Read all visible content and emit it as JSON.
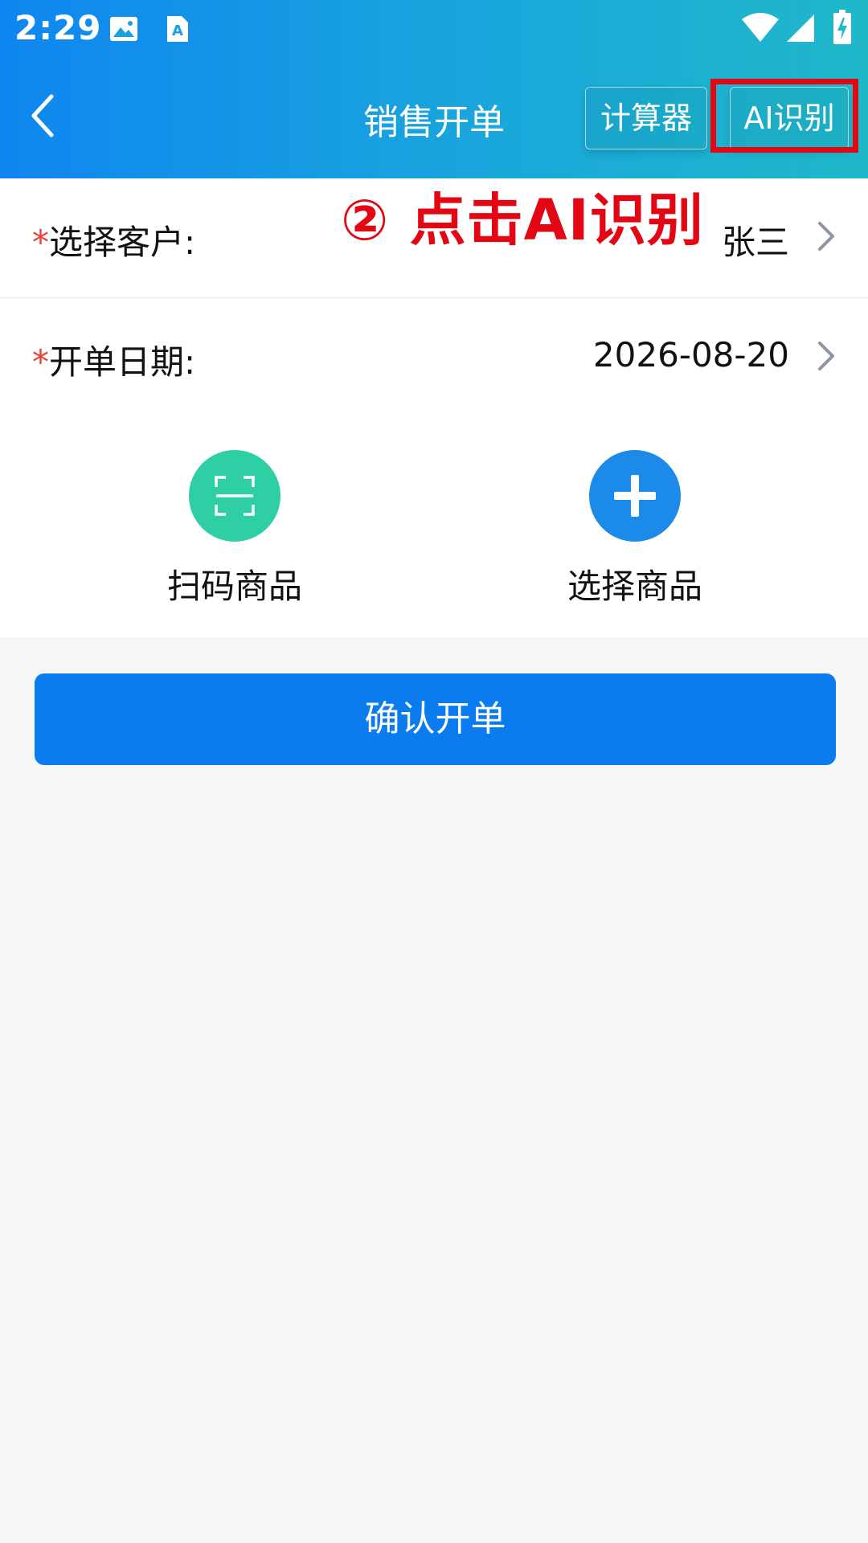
{
  "status_bar": {
    "time": "2:29"
  },
  "navbar": {
    "title": "销售开单",
    "calculator_label": "计算器",
    "ai_label": "AI识别"
  },
  "annotation": "② 点击AI识别",
  "form": {
    "customer": {
      "required_mark": "*",
      "label": "选择客户:",
      "value": "张三"
    },
    "date": {
      "required_mark": "*",
      "label": "开单日期:",
      "value": "2026-08-20"
    }
  },
  "actions": {
    "scan": {
      "label": "扫码商品",
      "color": "#2ecfa4"
    },
    "select": {
      "label": "选择商品",
      "color": "#1b8ae8"
    }
  },
  "confirm_label": "确认开单",
  "colors": {
    "header_start": "#0f86f0",
    "header_end": "#1fb8c9",
    "primary": "#0a7cf0",
    "highlight": "#e30613"
  }
}
